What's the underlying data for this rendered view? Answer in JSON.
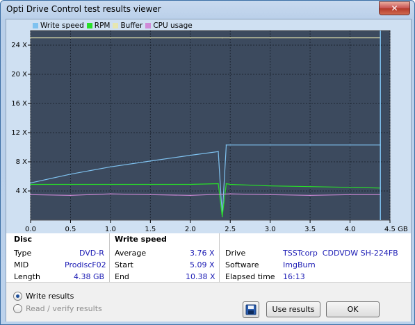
{
  "window": {
    "title": "Opti Drive Control test results viewer",
    "close_glyph": "✕"
  },
  "legend": [
    {
      "label": "Write speed",
      "color": "#7fc2f0"
    },
    {
      "label": "RPM",
      "color": "#28e028"
    },
    {
      "label": "Buffer",
      "color": "#e6e6b0"
    },
    {
      "label": "CPU usage",
      "color": "#d08ad8"
    }
  ],
  "chart_data": {
    "type": "line",
    "x_unit": "GB",
    "xlim": [
      0,
      4.5
    ],
    "ylim": [
      0,
      26
    ],
    "y_ticks": [
      "4 X",
      "8 X",
      "12 X",
      "16 X",
      "20 X",
      "24 X"
    ],
    "x_ticks": [
      "0.0",
      "0.5",
      "1.0",
      "1.5",
      "2.0",
      "2.5",
      "3.0",
      "3.5",
      "4.0",
      "4.5 GB"
    ],
    "grid": true,
    "legend_position": "top",
    "series": [
      {
        "name": "Write speed",
        "color": "#7fc2f0",
        "x": [
          0,
          0.5,
          1.0,
          1.5,
          2.0,
          2.35,
          2.4,
          2.45,
          2.5,
          3.0,
          3.5,
          4.0,
          4.38
        ],
        "y": [
          5.1,
          6.3,
          7.3,
          8.1,
          8.9,
          9.4,
          0.5,
          10.3,
          10.3,
          10.3,
          10.3,
          10.3,
          10.3
        ]
      },
      {
        "name": "RPM",
        "color": "#28e028",
        "x": [
          0,
          0.5,
          1.0,
          1.5,
          2.0,
          2.35,
          2.4,
          2.45,
          2.5,
          3.0,
          3.5,
          4.0,
          4.38
        ],
        "y": [
          4.9,
          4.9,
          4.9,
          4.9,
          4.9,
          5.0,
          0.5,
          5.0,
          4.9,
          4.7,
          4.6,
          4.5,
          4.4
        ]
      },
      {
        "name": "Buffer",
        "color": "#e6e6b0",
        "x": [
          0,
          0.5,
          1.0,
          1.5,
          2.0,
          2.4,
          2.5,
          3.0,
          3.5,
          4.0,
          4.38
        ],
        "y": [
          25,
          25,
          25,
          25,
          25,
          25,
          25,
          25,
          25,
          25,
          25
        ]
      },
      {
        "name": "CPU usage",
        "color": "#d08ad8",
        "x": [
          0,
          0.5,
          1.0,
          1.5,
          2.0,
          2.5,
          3.0,
          3.5,
          4.0,
          4.38
        ],
        "y": [
          3.5,
          3.4,
          3.6,
          3.5,
          3.4,
          3.6,
          3.5,
          3.4,
          3.5,
          3.5
        ]
      }
    ],
    "end_marker_x": 4.38
  },
  "info": {
    "disc_title": "Disc",
    "disc": [
      {
        "label": "Type",
        "value": "DVD-R"
      },
      {
        "label": "MID",
        "value": "ProdiscF02"
      },
      {
        "label": "Length",
        "value": "4.38 GB"
      }
    ],
    "speed_title": "Write speed",
    "speed": [
      {
        "label": "Average",
        "value": "3.76 X"
      },
      {
        "label": "Start",
        "value": "5.09 X"
      },
      {
        "label": "End",
        "value": "10.38 X"
      }
    ],
    "drive": [
      {
        "label": "Drive",
        "value": "TSSTcorp  CDDVDW SH-224FB"
      },
      {
        "label": "Software",
        "value": "ImgBurn"
      },
      {
        "label": "Elapsed time",
        "value": "16:13"
      }
    ]
  },
  "options": {
    "write_results": "Write results",
    "read_verify_results": "Read / verify results"
  },
  "buttons": {
    "use_results": "Use results",
    "ok": "OK"
  }
}
